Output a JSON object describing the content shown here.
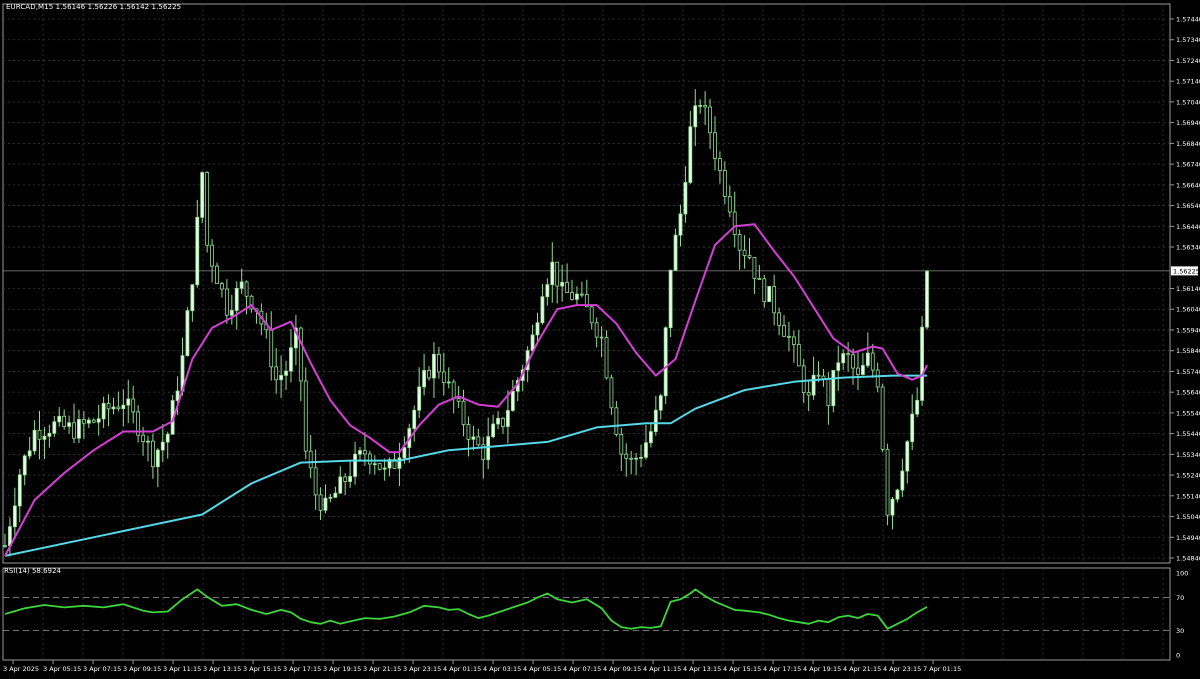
{
  "header": {
    "symbol": "EURCAD,M15",
    "ohlc": "1.56146 1.56226 1.56142 1.56225"
  },
  "rsi_header": "RSI(14) 58.6924",
  "colors": {
    "background": "#000000",
    "grid": "#3a3a3a",
    "candle": "#8fe08f",
    "candle_body": "#e6ffe6",
    "ma_fast": "#d63fd6",
    "ma_slow": "#55d8e8",
    "rsi_line": "#3cd63c"
  },
  "chart_data": [
    {
      "type": "candlestick",
      "ylim": [
        1.5484,
        1.5744
      ],
      "price_ticks": [
        "1.57440",
        "1.57340",
        "1.57240",
        "1.57140",
        "1.57040",
        "1.56940",
        "1.56840",
        "1.56740",
        "1.56640",
        "1.56540",
        "1.56440",
        "1.56340",
        "1.56140",
        "1.56040",
        "1.55940",
        "1.55840",
        "1.55740",
        "1.55640",
        "1.55540",
        "1.55440",
        "1.55340",
        "1.55240",
        "1.55140",
        "1.55040",
        "1.54940",
        "1.54840"
      ],
      "current_price_label": "1.56225",
      "current_price": 1.56225,
      "x_tick_labels": [
        "3 Apr 2025",
        "3 Apr 05:15",
        "3 Apr 07:15",
        "3 Apr 09:15",
        "3 Apr 11:15",
        "3 Apr 13:15",
        "3 Apr 15:15",
        "3 Apr 17:15",
        "3 Apr 19:15",
        "3 Apr 21:15",
        "3 Apr 23:15",
        "4 Apr 01:15",
        "4 Apr 03:15",
        "4 Apr 05:15",
        "4 Apr 07:15",
        "4 Apr 09:15",
        "4 Apr 11:15",
        "4 Apr 13:15",
        "4 Apr 15:15",
        "4 Apr 17:15",
        "4 Apr 19:15",
        "4 Apr 21:15",
        "4 Apr 23:15",
        "7 Apr 01:15"
      ],
      "close_path": [
        [
          0,
          1.549
        ],
        [
          3,
          1.5525
        ],
        [
          6,
          1.5545
        ],
        [
          10,
          1.5548
        ],
        [
          14,
          1.5546
        ],
        [
          18,
          1.555
        ],
        [
          21,
          1.5556
        ],
        [
          24,
          1.556
        ],
        [
          27,
          1.5548
        ],
        [
          30,
          1.5533
        ],
        [
          33,
          1.5544
        ],
        [
          36,
          1.558
        ],
        [
          38,
          1.562
        ],
        [
          40,
          1.567
        ],
        [
          41,
          1.5635
        ],
        [
          43,
          1.562
        ],
        [
          45,
          1.5605
        ],
        [
          48,
          1.5615
        ],
        [
          51,
          1.5605
        ],
        [
          53,
          1.559
        ],
        [
          55,
          1.557
        ],
        [
          57,
          1.5575
        ],
        [
          59,
          1.559
        ],
        [
          60,
          1.557
        ],
        [
          61,
          1.5535
        ],
        [
          63,
          1.5515
        ],
        [
          65,
          1.5508
        ],
        [
          67,
          1.5515
        ],
        [
          69,
          1.5522
        ],
        [
          71,
          1.553
        ],
        [
          73,
          1.5535
        ],
        [
          75,
          1.5532
        ],
        [
          77,
          1.5525
        ],
        [
          79,
          1.553
        ],
        [
          82,
          1.5548
        ],
        [
          85,
          1.557
        ],
        [
          87,
          1.558
        ],
        [
          89,
          1.5572
        ],
        [
          91,
          1.556
        ],
        [
          93,
          1.555
        ],
        [
          95,
          1.554
        ],
        [
          97,
          1.5535
        ],
        [
          99,
          1.5545
        ],
        [
          101,
          1.555
        ],
        [
          104,
          1.557
        ],
        [
          107,
          1.559
        ],
        [
          109,
          1.5615
        ],
        [
          111,
          1.5625
        ],
        [
          113,
          1.5612
        ],
        [
          116,
          1.561
        ],
        [
          119,
          1.56
        ],
        [
          121,
          1.559
        ],
        [
          123,
          1.556
        ],
        [
          125,
          1.5535
        ],
        [
          127,
          1.553
        ],
        [
          129,
          1.5535
        ],
        [
          131,
          1.5545
        ],
        [
          133,
          1.556
        ],
        [
          135,
          1.5625
        ],
        [
          137,
          1.565
        ],
        [
          139,
          1.569
        ],
        [
          141,
          1.5705
        ],
        [
          143,
          1.569
        ],
        [
          145,
          1.567
        ],
        [
          147,
          1.5655
        ],
        [
          149,
          1.5635
        ],
        [
          151,
          1.563
        ],
        [
          153,
          1.5615
        ],
        [
          155,
          1.561
        ],
        [
          157,
          1.56
        ],
        [
          159,
          1.559
        ],
        [
          161,
          1.5575
        ],
        [
          163,
          1.556
        ],
        [
          165,
          1.5575
        ],
        [
          167,
          1.556
        ],
        [
          169,
          1.558
        ],
        [
          171,
          1.558
        ],
        [
          173,
          1.557
        ],
        [
          175,
          1.558
        ],
        [
          177,
          1.557
        ],
        [
          179,
          1.5508
        ],
        [
          181,
          1.552
        ],
        [
          183,
          1.554
        ],
        [
          185,
          1.556
        ],
        [
          187,
          1.56225
        ]
      ],
      "ma_fast_path": [
        [
          0,
          1.5485
        ],
        [
          6,
          1.5512
        ],
        [
          12,
          1.5525
        ],
        [
          18,
          1.5536
        ],
        [
          24,
          1.5545
        ],
        [
          30,
          1.5545
        ],
        [
          34,
          1.555
        ],
        [
          38,
          1.558
        ],
        [
          42,
          1.5595
        ],
        [
          46,
          1.56
        ],
        [
          50,
          1.5606
        ],
        [
          54,
          1.5594
        ],
        [
          58,
          1.5598
        ],
        [
          62,
          1.5578
        ],
        [
          66,
          1.556
        ],
        [
          70,
          1.5548
        ],
        [
          74,
          1.5542
        ],
        [
          78,
          1.5535
        ],
        [
          80,
          1.5535
        ],
        [
          84,
          1.5548
        ],
        [
          88,
          1.5558
        ],
        [
          92,
          1.5562
        ],
        [
          96,
          1.5558
        ],
        [
          100,
          1.5557
        ],
        [
          104,
          1.5568
        ],
        [
          108,
          1.5588
        ],
        [
          112,
          1.5604
        ],
        [
          116,
          1.5606
        ],
        [
          120,
          1.5606
        ],
        [
          124,
          1.5597
        ],
        [
          128,
          1.5583
        ],
        [
          132,
          1.5572
        ],
        [
          136,
          1.558
        ],
        [
          140,
          1.5608
        ],
        [
          144,
          1.5635
        ],
        [
          148,
          1.5644
        ],
        [
          152,
          1.5645
        ],
        [
          156,
          1.5632
        ],
        [
          160,
          1.562
        ],
        [
          164,
          1.5605
        ],
        [
          168,
          1.559
        ],
        [
          172,
          1.5583
        ],
        [
          176,
          1.5586
        ],
        [
          178,
          1.5585
        ],
        [
          181,
          1.5573
        ],
        [
          184,
          1.557
        ],
        [
          186,
          1.5572
        ],
        [
          187,
          1.5577
        ]
      ],
      "ma_slow_path": [
        [
          0,
          1.5485
        ],
        [
          20,
          1.5495
        ],
        [
          40,
          1.5505
        ],
        [
          50,
          1.552
        ],
        [
          60,
          1.553
        ],
        [
          70,
          1.5531
        ],
        [
          80,
          1.5531
        ],
        [
          90,
          1.5536
        ],
        [
          100,
          1.5538
        ],
        [
          110,
          1.554
        ],
        [
          120,
          1.5547
        ],
        [
          130,
          1.5549
        ],
        [
          135,
          1.5549
        ],
        [
          140,
          1.5556
        ],
        [
          150,
          1.5565
        ],
        [
          160,
          1.5569
        ],
        [
          170,
          1.5571
        ],
        [
          180,
          1.5572
        ],
        [
          187,
          1.5572
        ]
      ],
      "bar_count": 188
    },
    {
      "type": "line",
      "title": "RSI(14) 58.6924",
      "ylim": [
        0,
        100
      ],
      "y_ticks": [
        "100",
        "70",
        "30",
        "0"
      ],
      "levels": [
        70,
        30
      ],
      "rsi_path": [
        [
          0,
          50
        ],
        [
          4,
          57
        ],
        [
          8,
          61
        ],
        [
          12,
          58
        ],
        [
          16,
          60
        ],
        [
          20,
          58
        ],
        [
          24,
          62
        ],
        [
          28,
          54
        ],
        [
          30,
          52
        ],
        [
          33,
          53
        ],
        [
          36,
          68
        ],
        [
          39,
          80
        ],
        [
          41,
          71
        ],
        [
          44,
          60
        ],
        [
          47,
          62
        ],
        [
          50,
          55
        ],
        [
          53,
          50
        ],
        [
          56,
          55
        ],
        [
          58,
          52
        ],
        [
          60,
          44
        ],
        [
          62,
          40
        ],
        [
          64,
          38
        ],
        [
          66,
          42
        ],
        [
          68,
          38
        ],
        [
          70,
          41
        ],
        [
          73,
          45
        ],
        [
          76,
          44
        ],
        [
          79,
          47
        ],
        [
          82,
          52
        ],
        [
          85,
          60
        ],
        [
          88,
          58
        ],
        [
          90,
          55
        ],
        [
          92,
          56
        ],
        [
          94,
          50
        ],
        [
          96,
          45
        ],
        [
          98,
          48
        ],
        [
          100,
          52
        ],
        [
          103,
          58
        ],
        [
          106,
          64
        ],
        [
          108,
          70
        ],
        [
          110,
          75
        ],
        [
          112,
          68
        ],
        [
          115,
          64
        ],
        [
          118,
          68
        ],
        [
          121,
          57
        ],
        [
          123,
          42
        ],
        [
          125,
          34
        ],
        [
          127,
          32
        ],
        [
          129,
          34
        ],
        [
          131,
          33
        ],
        [
          133,
          35
        ],
        [
          135,
          65
        ],
        [
          137,
          68
        ],
        [
          139,
          75
        ],
        [
          140,
          80
        ],
        [
          142,
          72
        ],
        [
          144,
          65
        ],
        [
          146,
          60
        ],
        [
          148,
          55
        ],
        [
          150,
          54
        ],
        [
          153,
          52
        ],
        [
          155,
          49
        ],
        [
          157,
          45
        ],
        [
          159,
          42
        ],
        [
          161,
          40
        ],
        [
          163,
          38
        ],
        [
          165,
          42
        ],
        [
          167,
          40
        ],
        [
          169,
          46
        ],
        [
          171,
          48
        ],
        [
          173,
          45
        ],
        [
          175,
          50
        ],
        [
          177,
          48
        ],
        [
          179,
          32
        ],
        [
          181,
          38
        ],
        [
          183,
          44
        ],
        [
          185,
          52
        ],
        [
          187,
          58.69
        ]
      ]
    }
  ]
}
